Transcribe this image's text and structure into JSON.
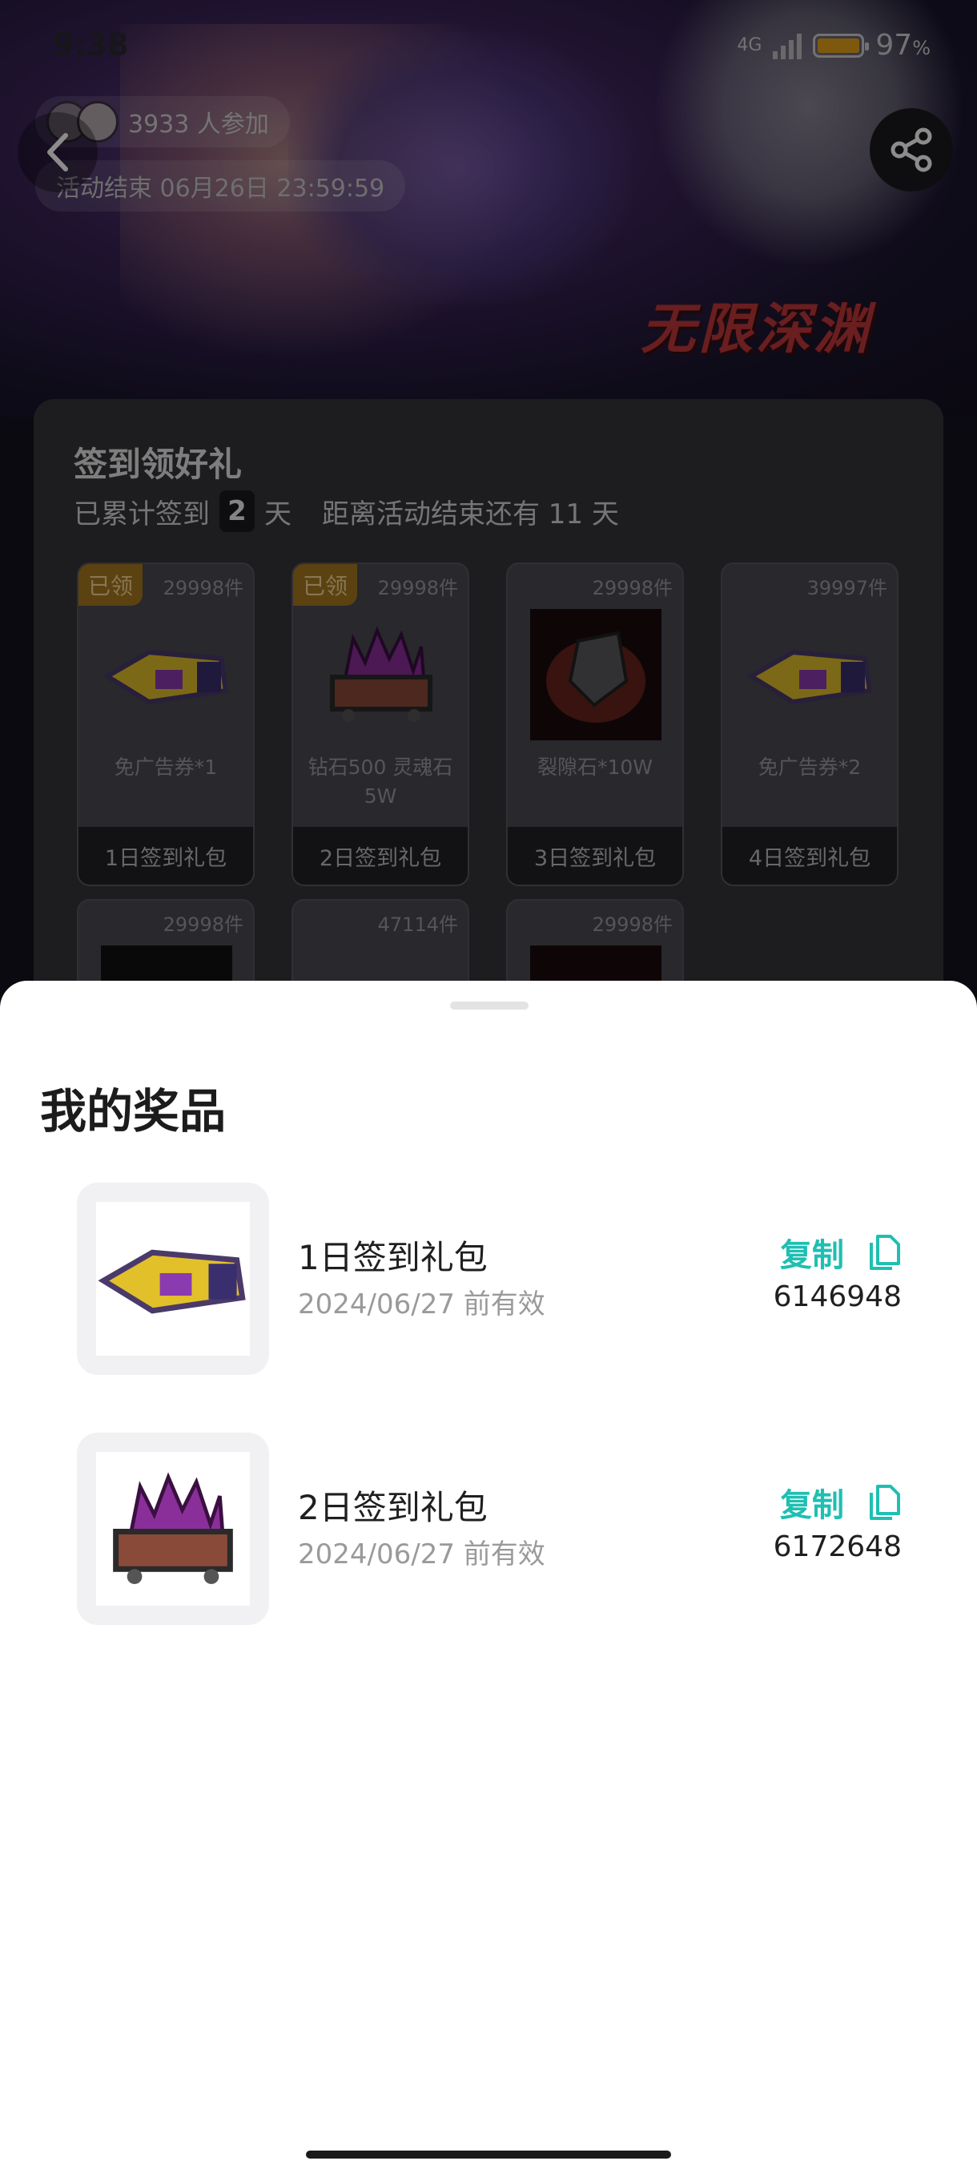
{
  "status_bar": {
    "time": "9:38",
    "battery": "97",
    "battery_unit": "%",
    "network": "4G"
  },
  "banner": {
    "game_logo": "无限深渊"
  },
  "activity": {
    "participants": "3933 人参加",
    "end_time": "活动结束 06月26日 23:59:59"
  },
  "signin": {
    "title": "签到领好礼",
    "sub_prefix": "已累计签到",
    "days": "2",
    "sub_unit": "天",
    "remaining": "距离活动结束还有 11 天",
    "rewards": [
      {
        "claimed": "已领",
        "stock": "29998件",
        "name": "免广告券*1",
        "foot": "1日签到礼包",
        "icon": "ticket-icon"
      },
      {
        "claimed": "已领",
        "stock": "29998件",
        "name": "钻石500 灵魂石5W",
        "foot": "2日签到礼包",
        "icon": "crystal-cart-icon"
      },
      {
        "stock": "29998件",
        "name": "裂隙石*10W",
        "foot": "3日签到礼包",
        "icon": "rift-stone-icon"
      },
      {
        "stock": "39997件",
        "name": "免广告券*2",
        "foot": "4日签到礼包",
        "icon": "ticket-icon"
      },
      {
        "stock": "29998件"
      },
      {
        "stock": "47114件"
      },
      {
        "stock": "29998件"
      }
    ]
  },
  "sheet": {
    "title": "我的奖品",
    "prizes": [
      {
        "name": "1日签到礼包",
        "valid": "2024/06/27 前有效",
        "copy_label": "复制",
        "code": "6146948",
        "icon": "ticket-icon"
      },
      {
        "name": "2日签到礼包",
        "valid": "2024/06/27 前有效",
        "copy_label": "复制",
        "code": "6172648",
        "icon": "crystal-cart-icon"
      }
    ]
  },
  "colors": {
    "accent": "#1fbfb2",
    "claimed_badge": "#a6781e",
    "battery": "#e6a219"
  }
}
